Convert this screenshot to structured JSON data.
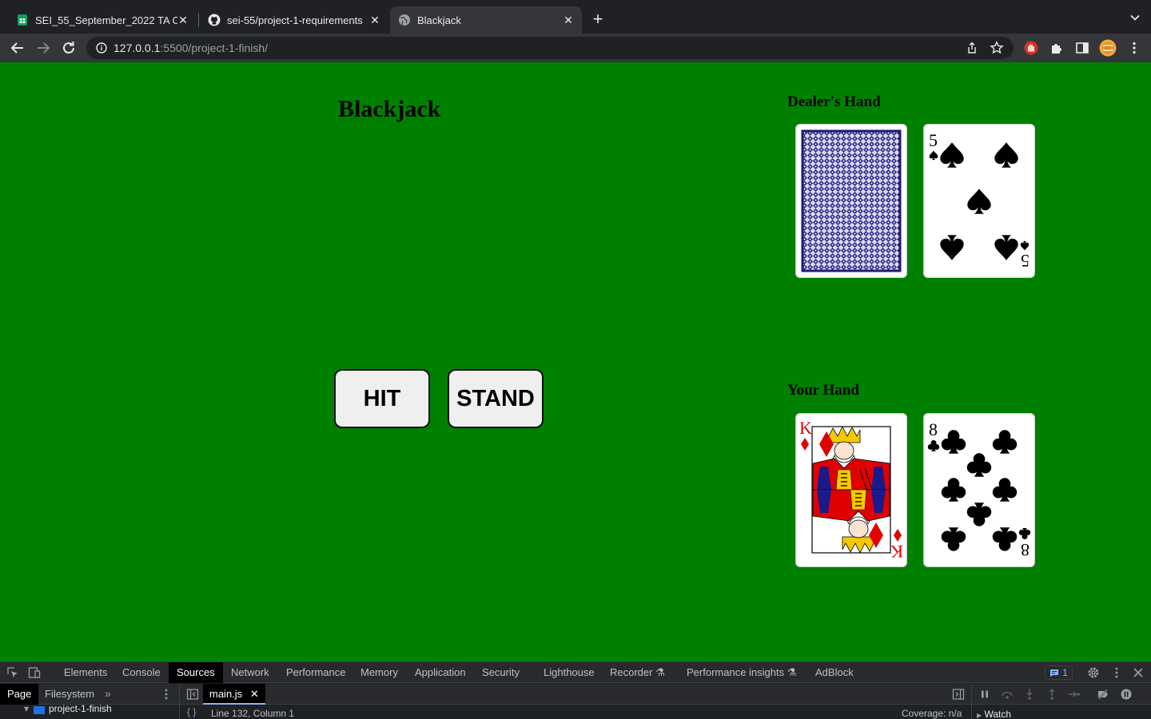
{
  "browser": {
    "tabs": [
      {
        "title": "SEI_55_September_2022 TA O",
        "favicon": "sheets-icon"
      },
      {
        "title": "sei-55/project-1-requirements",
        "favicon": "github-icon"
      },
      {
        "title": "Blackjack",
        "favicon": "globe-icon",
        "active": true
      }
    ],
    "url_host": "127.0.0.1",
    "url_path": ":5500/project-1-finish/"
  },
  "page": {
    "title": "Blackjack",
    "dealer_title": "Dealer's Hand",
    "player_title": "Your Hand",
    "hit_label": "HIT",
    "stand_label": "STAND",
    "dealer_cards": [
      {
        "face": "back",
        "color": "#2a2a8a"
      },
      {
        "rank": "5",
        "suit": "spades"
      }
    ],
    "player_cards": [
      {
        "rank": "K",
        "suit": "diamonds"
      },
      {
        "rank": "8",
        "suit": "clubs"
      }
    ],
    "colors": {
      "table": "#008000",
      "red_suit": "#e00000"
    }
  },
  "devtools": {
    "tabs": [
      "Elements",
      "Console",
      "Sources",
      "Network",
      "Performance",
      "Memory",
      "Application",
      "Security",
      "Lighthouse",
      "Recorder",
      "Performance insights",
      "AdBlock"
    ],
    "active_tab": "Sources",
    "issues_count": "1",
    "navigator_tabs": [
      "Page",
      "Filesystem"
    ],
    "tree_item": "project-1-finish",
    "open_file": "main.js",
    "cursor_position": "Line 132, Column 1",
    "coverage": "Coverage: n/a",
    "watch_label": "Watch"
  }
}
